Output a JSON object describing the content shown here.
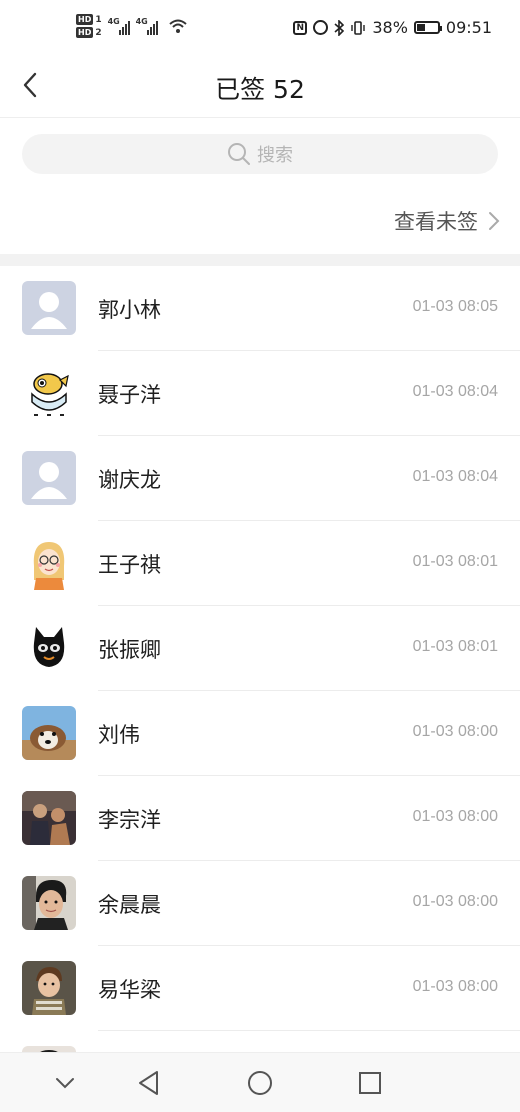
{
  "status_bar": {
    "hd1_label": "HD",
    "hd1_num": "1",
    "hd2_label": "HD",
    "hd2_num": "2",
    "sig1_label": "4G",
    "sig2_label": "4G",
    "battery_percent": "38%",
    "battery_level": 0.38,
    "time": "09:51",
    "nfc_label": "N"
  },
  "header": {
    "title": "已签 52",
    "back_icon": "chevron-left-icon"
  },
  "search": {
    "placeholder": "搜索",
    "icon": "search-icon"
  },
  "unsigned_link": {
    "label": "查看未签",
    "icon": "chevron-right-icon"
  },
  "signed_list": [
    {
      "name": "郭小林",
      "time": "01-03 08:05",
      "avatar": "default-avatar"
    },
    {
      "name": "聂子洋",
      "time": "01-03 08:04",
      "avatar": "fish-cartoon-avatar"
    },
    {
      "name": "谢庆龙",
      "time": "01-03 08:04",
      "avatar": "default-avatar"
    },
    {
      "name": "王子祺",
      "time": "01-03 08:01",
      "avatar": "girl-cartoon-avatar"
    },
    {
      "name": "张振卿",
      "time": "01-03 08:01",
      "avatar": "black-cat-avatar"
    },
    {
      "name": "刘伟",
      "time": "01-03 08:00",
      "avatar": "dog-photo-avatar"
    },
    {
      "name": "李宗洋",
      "time": "01-03 08:00",
      "avatar": "people-photo-avatar"
    },
    {
      "name": "余晨晨",
      "time": "01-03 08:00",
      "avatar": "boy-photo-avatar"
    },
    {
      "name": "易华梁",
      "time": "01-03 08:00",
      "avatar": "child-photo-avatar"
    }
  ],
  "nav_bar": {
    "icons": [
      "collapse-icon",
      "back-triangle-icon",
      "home-circle-icon",
      "recents-square-icon"
    ]
  },
  "colors": {
    "text_primary": "#1f1f1f",
    "text_time": "#a6a6a6",
    "search_bg": "#f3f3f3",
    "default_avatar_bg": "#cdd3e2"
  }
}
